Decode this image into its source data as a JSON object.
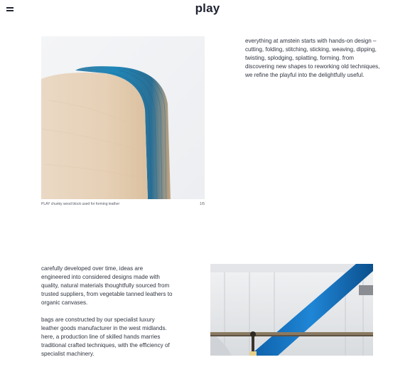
{
  "header": {
    "title": "play",
    "menu_icon": "hamburger-menu-icon"
  },
  "gallery": {
    "image_1": {
      "subject": "wood-block-with-blue-dyed-edge",
      "caption": "PLAY chunky wood block used for forming leather",
      "counter": "1/5"
    },
    "image_2": {
      "subject": "factory-blue-pipe"
    }
  },
  "intro": {
    "text": "everything at amstein starts with hands-on design – cutting, folding, stitching, sticking, weaving, dipping, twisting, splodging, splatting, forming. from discovering new shapes to reworking old techniques, we refine the playful into the delightfully useful."
  },
  "process": {
    "paragraph_1": "carefully developed over time, ideas are engineered into considered designs made with quality, natural materials thoughtfully sourced from trusted suppliers, from vegetable tanned leathers to organic canvases.",
    "paragraph_2": "bags are constructed by our specialist luxury leather goods manufacturer in the west midlands. here, a production line of skilled hands marries traditional crafted techniques, with the efficiency of specialist machinery."
  },
  "colors": {
    "text": "#2f3440",
    "title": "#1e2230",
    "accent_blue": "#1f7fc4",
    "wood": "#e8d2b6",
    "background": "#ffffff"
  }
}
